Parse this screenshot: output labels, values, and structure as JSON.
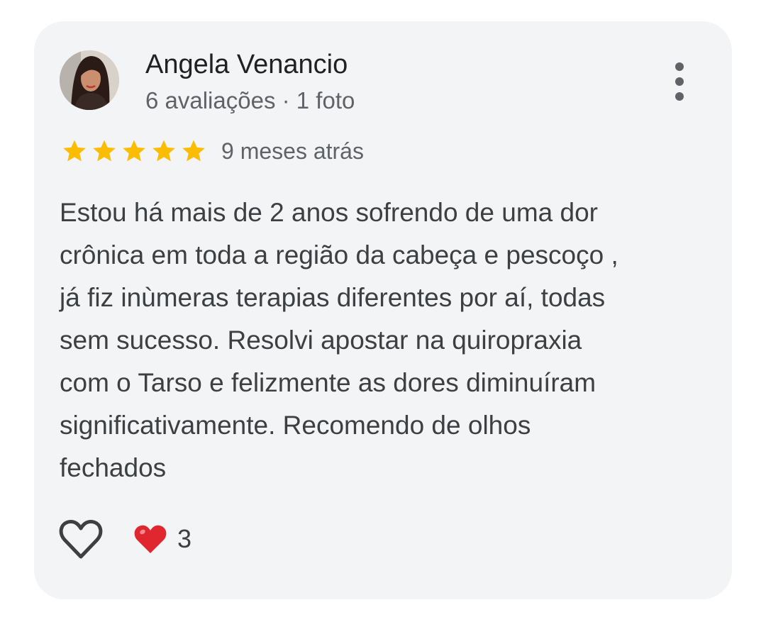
{
  "reviewer": {
    "name": "Angela Venancio",
    "meta": "6 avaliações · 1 foto"
  },
  "rating": {
    "stars": 5,
    "max": 5,
    "time": "9 meses atrás"
  },
  "review": {
    "text": "Estou há mais de 2 anos sofrendo de uma dor\ncrônica em toda a região da cabeça e pescoço ,\njá fiz inùmeras terapias diferentes por aí, todas\nsem sucesso. Resolvi apostar na quiropraxia\ncom o Tarso e felizmente as dores diminuíram\nsignificativamente. Recomendo de olhos\nfechados"
  },
  "reactions": {
    "emoji": "❤️",
    "count": "3"
  },
  "icons": {
    "like": "heart-outline-icon",
    "more": "more-vert-icon",
    "star": "star-icon",
    "reaction": "red-heart-icon"
  },
  "colors": {
    "card_background": "#f3f4f6",
    "star": "#fbbc04",
    "primary_text": "#202124",
    "secondary_text": "#5f6368",
    "reaction_heart": "#e0262e"
  }
}
